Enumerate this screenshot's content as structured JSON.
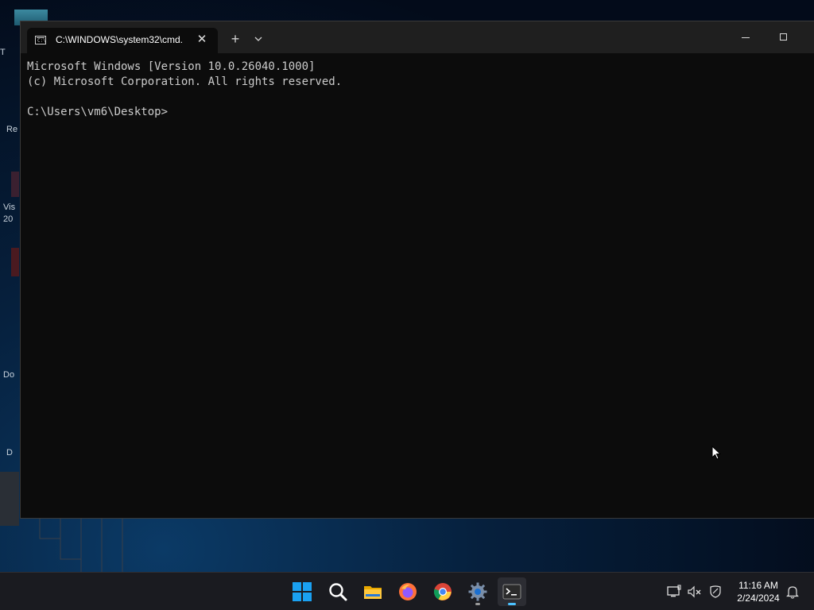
{
  "window": {
    "tab_title": "C:\\WINDOWS\\system32\\cmd.",
    "new_tab_symbol": "+",
    "close_symbol": "✕"
  },
  "console": {
    "line1": "Microsoft Windows [Version 10.0.26040.1000]",
    "line2": "(c) Microsoft Corporation. All rights reserved.",
    "line3": "",
    "line4": "C:\\Users\\vm6\\Desktop>"
  },
  "desktop": {
    "icon_labels": [
      "T",
      "Re",
      "Vis",
      "20",
      "Do",
      "D"
    ]
  },
  "taskbar": {
    "apps": [
      "start",
      "search",
      "file-explorer",
      "firefox",
      "chrome",
      "settings",
      "terminal"
    ],
    "active_app": "terminal",
    "clock_time": "11:16 AM",
    "clock_date": "2/24/2024"
  },
  "colors": {
    "console_bg": "#0c0c0c",
    "titlebar_bg": "#1f1f1f",
    "taskbar_bg": "#1a1b20",
    "accent": "#4cc2ff"
  }
}
